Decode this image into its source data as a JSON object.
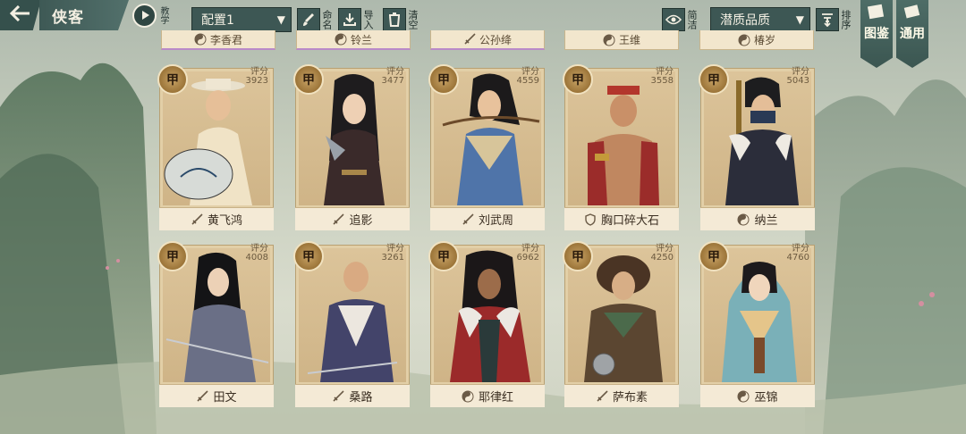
{
  "header": {
    "title": "侠客",
    "tutorial_label": "教学",
    "config_select": "配置1",
    "rename_label": "命名",
    "import_label": "导入",
    "clear_label": "清空",
    "simple_label": "简洁",
    "sort_select": "潜质品质",
    "sort_label": "排序",
    "codex_label": "图鉴",
    "common_label": "通用"
  },
  "top_row": [
    {
      "name": "李香君",
      "icon": "yin-yang-icon"
    },
    {
      "name": "铃兰",
      "icon": "yin-yang-icon"
    },
    {
      "name": "公孙绛",
      "icon": "sword-icon"
    },
    {
      "name": "王维",
      "icon": "yin-yang-icon"
    },
    {
      "name": "椿岁",
      "icon": "yin-yang-icon"
    }
  ],
  "cards": [
    {
      "grade": "甲",
      "score_label": "评分",
      "score": "3923",
      "name": "黄飞鸿",
      "type_icon": "sword-icon"
    },
    {
      "grade": "甲",
      "score_label": "评分",
      "score": "3477",
      "name": "追影",
      "type_icon": "sword-icon"
    },
    {
      "grade": "甲",
      "score_label": "评分",
      "score": "4559",
      "name": "刘武周",
      "type_icon": "sword-icon"
    },
    {
      "grade": "甲",
      "score_label": "评分",
      "score": "3558",
      "name": "胸口碎大石",
      "type_icon": "shield-icon"
    },
    {
      "grade": "甲",
      "score_label": "评分",
      "score": "5043",
      "name": "纳兰",
      "type_icon": "yin-yang-icon"
    },
    {
      "grade": "甲",
      "score_label": "评分",
      "score": "4008",
      "name": "田文",
      "type_icon": "sword-icon"
    },
    {
      "grade": "甲",
      "score_label": "评分",
      "score": "3261",
      "name": "桑路",
      "type_icon": "sword-icon"
    },
    {
      "grade": "甲",
      "score_label": "评分",
      "score": "6962",
      "name": "耶律红",
      "type_icon": "yin-yang-icon"
    },
    {
      "grade": "甲",
      "score_label": "评分",
      "score": "4250",
      "name": "萨布素",
      "type_icon": "sword-icon"
    },
    {
      "grade": "甲",
      "score_label": "评分",
      "score": "4760",
      "name": "巫锦",
      "type_icon": "yin-yang-icon"
    }
  ],
  "colors": {
    "panel": "#3d5754",
    "card": "#e2cfa7",
    "grade": "#9b7438"
  }
}
